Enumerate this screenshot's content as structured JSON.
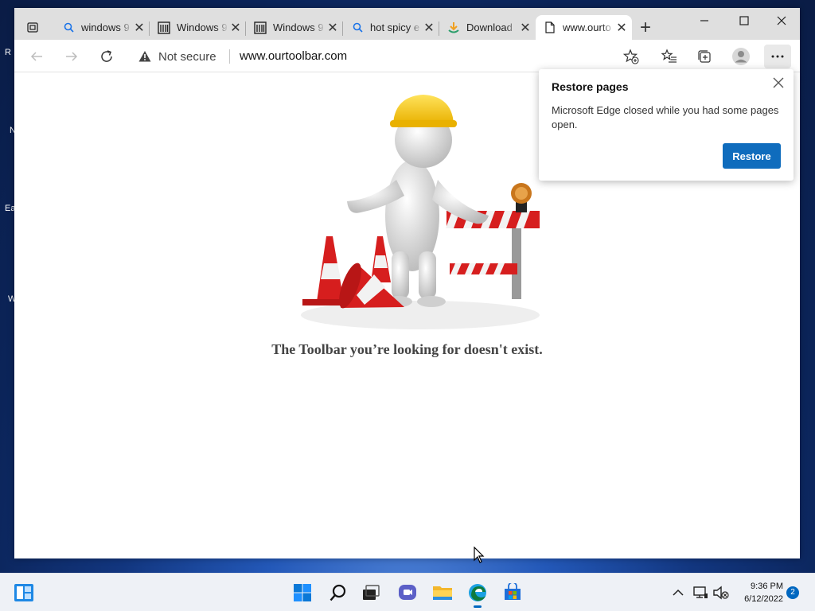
{
  "desktop": {
    "icon_peeks": [
      "R",
      "N",
      "Ea",
      "W"
    ]
  },
  "browser": {
    "tabs": [
      {
        "label": "windows 9",
        "icon": "search-icon"
      },
      {
        "label": "Windows 9",
        "icon": "library-icon"
      },
      {
        "label": "Windows 9",
        "icon": "library-icon"
      },
      {
        "label": "hot spicy e",
        "icon": "search-icon"
      },
      {
        "label": "Download",
        "icon": "download-app-icon"
      },
      {
        "label": "www.ourto",
        "icon": "page-icon",
        "active": true
      }
    ],
    "address_bar": {
      "security_label": "Not secure",
      "url": "www.ourtoolbar.com"
    },
    "page": {
      "error_message": "The Toolbar you’re looking for doesn't exist."
    },
    "restore_popup": {
      "title": "Restore pages",
      "message": "Microsoft Edge closed while you had some pages open.",
      "button_label": "Restore"
    }
  },
  "taskbar": {
    "time": "9:36 PM",
    "date": "6/12/2022",
    "notification_count": "2",
    "pinned_apps": [
      "start-icon",
      "search-icon",
      "task-view-icon",
      "chat-icon",
      "file-explorer-icon",
      "edge-icon",
      "store-icon"
    ]
  },
  "colors": {
    "accent": "#0f6cbd",
    "taskbar": "#eef1f6",
    "tabstrip": "#dfdfdf"
  }
}
